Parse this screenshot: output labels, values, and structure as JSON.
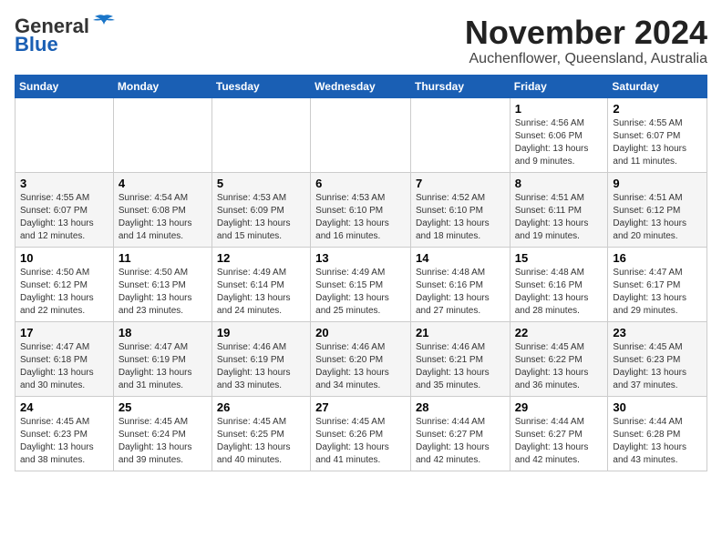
{
  "header": {
    "logo_general": "General",
    "logo_blue": "Blue",
    "month": "November 2024",
    "location": "Auchenflower, Queensland, Australia"
  },
  "weekdays": [
    "Sunday",
    "Monday",
    "Tuesday",
    "Wednesday",
    "Thursday",
    "Friday",
    "Saturday"
  ],
  "weeks": [
    [
      {
        "day": "",
        "info": ""
      },
      {
        "day": "",
        "info": ""
      },
      {
        "day": "",
        "info": ""
      },
      {
        "day": "",
        "info": ""
      },
      {
        "day": "",
        "info": ""
      },
      {
        "day": "1",
        "info": "Sunrise: 4:56 AM\nSunset: 6:06 PM\nDaylight: 13 hours and 9 minutes."
      },
      {
        "day": "2",
        "info": "Sunrise: 4:55 AM\nSunset: 6:07 PM\nDaylight: 13 hours and 11 minutes."
      }
    ],
    [
      {
        "day": "3",
        "info": "Sunrise: 4:55 AM\nSunset: 6:07 PM\nDaylight: 13 hours and 12 minutes."
      },
      {
        "day": "4",
        "info": "Sunrise: 4:54 AM\nSunset: 6:08 PM\nDaylight: 13 hours and 14 minutes."
      },
      {
        "day": "5",
        "info": "Sunrise: 4:53 AM\nSunset: 6:09 PM\nDaylight: 13 hours and 15 minutes."
      },
      {
        "day": "6",
        "info": "Sunrise: 4:53 AM\nSunset: 6:10 PM\nDaylight: 13 hours and 16 minutes."
      },
      {
        "day": "7",
        "info": "Sunrise: 4:52 AM\nSunset: 6:10 PM\nDaylight: 13 hours and 18 minutes."
      },
      {
        "day": "8",
        "info": "Sunrise: 4:51 AM\nSunset: 6:11 PM\nDaylight: 13 hours and 19 minutes."
      },
      {
        "day": "9",
        "info": "Sunrise: 4:51 AM\nSunset: 6:12 PM\nDaylight: 13 hours and 20 minutes."
      }
    ],
    [
      {
        "day": "10",
        "info": "Sunrise: 4:50 AM\nSunset: 6:12 PM\nDaylight: 13 hours and 22 minutes."
      },
      {
        "day": "11",
        "info": "Sunrise: 4:50 AM\nSunset: 6:13 PM\nDaylight: 13 hours and 23 minutes."
      },
      {
        "day": "12",
        "info": "Sunrise: 4:49 AM\nSunset: 6:14 PM\nDaylight: 13 hours and 24 minutes."
      },
      {
        "day": "13",
        "info": "Sunrise: 4:49 AM\nSunset: 6:15 PM\nDaylight: 13 hours and 25 minutes."
      },
      {
        "day": "14",
        "info": "Sunrise: 4:48 AM\nSunset: 6:16 PM\nDaylight: 13 hours and 27 minutes."
      },
      {
        "day": "15",
        "info": "Sunrise: 4:48 AM\nSunset: 6:16 PM\nDaylight: 13 hours and 28 minutes."
      },
      {
        "day": "16",
        "info": "Sunrise: 4:47 AM\nSunset: 6:17 PM\nDaylight: 13 hours and 29 minutes."
      }
    ],
    [
      {
        "day": "17",
        "info": "Sunrise: 4:47 AM\nSunset: 6:18 PM\nDaylight: 13 hours and 30 minutes."
      },
      {
        "day": "18",
        "info": "Sunrise: 4:47 AM\nSunset: 6:19 PM\nDaylight: 13 hours and 31 minutes."
      },
      {
        "day": "19",
        "info": "Sunrise: 4:46 AM\nSunset: 6:19 PM\nDaylight: 13 hours and 33 minutes."
      },
      {
        "day": "20",
        "info": "Sunrise: 4:46 AM\nSunset: 6:20 PM\nDaylight: 13 hours and 34 minutes."
      },
      {
        "day": "21",
        "info": "Sunrise: 4:46 AM\nSunset: 6:21 PM\nDaylight: 13 hours and 35 minutes."
      },
      {
        "day": "22",
        "info": "Sunrise: 4:45 AM\nSunset: 6:22 PM\nDaylight: 13 hours and 36 minutes."
      },
      {
        "day": "23",
        "info": "Sunrise: 4:45 AM\nSunset: 6:23 PM\nDaylight: 13 hours and 37 minutes."
      }
    ],
    [
      {
        "day": "24",
        "info": "Sunrise: 4:45 AM\nSunset: 6:23 PM\nDaylight: 13 hours and 38 minutes."
      },
      {
        "day": "25",
        "info": "Sunrise: 4:45 AM\nSunset: 6:24 PM\nDaylight: 13 hours and 39 minutes."
      },
      {
        "day": "26",
        "info": "Sunrise: 4:45 AM\nSunset: 6:25 PM\nDaylight: 13 hours and 40 minutes."
      },
      {
        "day": "27",
        "info": "Sunrise: 4:45 AM\nSunset: 6:26 PM\nDaylight: 13 hours and 41 minutes."
      },
      {
        "day": "28",
        "info": "Sunrise: 4:44 AM\nSunset: 6:27 PM\nDaylight: 13 hours and 42 minutes."
      },
      {
        "day": "29",
        "info": "Sunrise: 4:44 AM\nSunset: 6:27 PM\nDaylight: 13 hours and 42 minutes."
      },
      {
        "day": "30",
        "info": "Sunrise: 4:44 AM\nSunset: 6:28 PM\nDaylight: 13 hours and 43 minutes."
      }
    ]
  ]
}
